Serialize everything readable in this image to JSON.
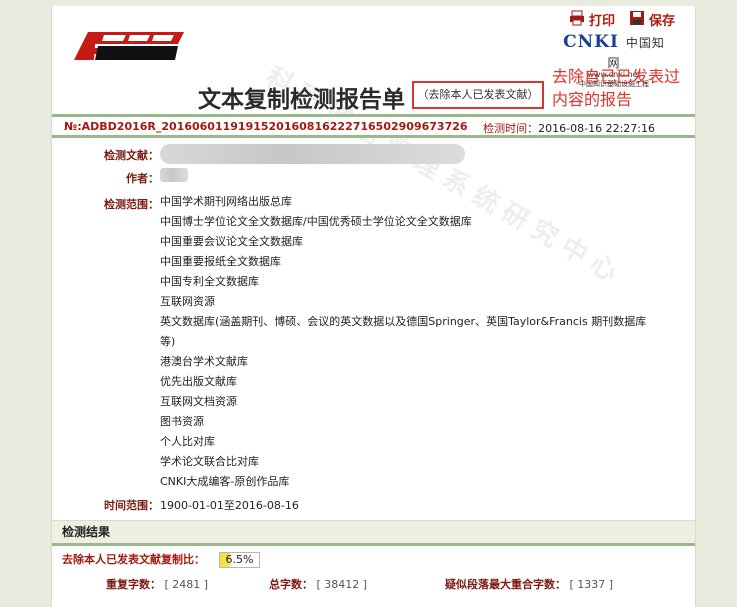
{
  "toolbar": {
    "print_label": "打印",
    "save_label": "保存"
  },
  "cnki": {
    "brand": "CNKI",
    "brand_cn": "中国知网",
    "url": "www.cnki.net",
    "sub": "中国知识基础设施工程"
  },
  "report": {
    "title": "文本复制检测报告单",
    "subtitle": "（去除本人已发表文献）",
    "annotation": "去除自己已发表过内容的报告",
    "doc_no": "№:ADBD2016R_2016060119191520160816222716502909673726",
    "time_label": "检测时间：",
    "time_value": "2016-08-16 22:27:16"
  },
  "fields": {
    "doc_label": "检测文献：",
    "author_label": "作者：",
    "scope_label": "检测范围：",
    "period_label": "时间范围：",
    "period_value": "1900-01-01至2016-08-16"
  },
  "scope": [
    "中国学术期刊网络出版总库",
    "中国博士学位论文全文数据库/中国优秀硕士学位论文全文数据库",
    "中国重要会议论文全文数据库",
    "中国重要报纸全文数据库",
    "中国专利全文数据库",
    "互联网资源",
    "英文数据库(涵盖期刊、博硕、会议的英文数据以及德国Springer、英国Taylor&Francis 期刊数据库",
    "等)",
    "港澳台学术文献库",
    "优先出版文献库",
    "互联网文档资源",
    "图书资源",
    "个人比对库",
    "学术论文联合比对库",
    "CNKI大成编客-原创作品库"
  ],
  "results": {
    "header": "检测结果",
    "ratio_label": "去除本人已发表文献复制比：",
    "ratio_value": "6.5%",
    "ratio_fraction": 0.065,
    "repeat_label": "重复字数：",
    "repeat_value": "[ 2481 ]",
    "total_label": "总字数：",
    "total_value": "[ 38412 ]",
    "max_label": "疑似段落最大重合字数：",
    "max_value": "[ 1337 ]"
  },
  "watermark": "科研诚信管理系统研究中心",
  "colors": {
    "accent": "#a31a12",
    "green_rule": "#99b98d",
    "annotation": "#e0332b"
  }
}
